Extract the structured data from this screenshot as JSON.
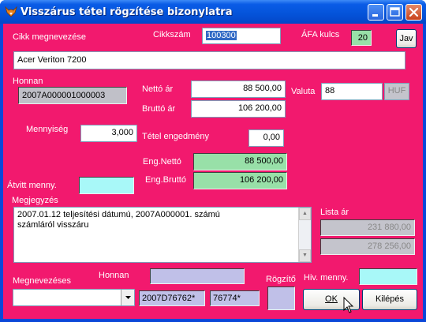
{
  "window": {
    "title": "Visszárus tétel rögzítése bizonylatra"
  },
  "labels": {
    "cikk_megnevezese": "Cikk megnevezése",
    "cikkszam": "Cikkszám",
    "afa_kulcs": "ÁFA kulcs",
    "honnan": "Honnan",
    "netto_ar": "Nettó ár",
    "brutto_ar": "Bruttó ár",
    "valuta": "Valuta",
    "mennyiseg": "Mennyiség",
    "tetel_engedmeny": "Tétel engedmény",
    "eng_netto": "Eng.Nettó",
    "eng_brutto": "Eng.Bruttó",
    "atvitt_menny": "Átvitt menny.",
    "megjegyzes": "Megjegyzés",
    "lista_ar": "Lista ár",
    "megnevezeses": "Megnevezéses",
    "honnan2": "Honnan",
    "rogzito": "Rögzítő",
    "hiv_menny": "Hiv. menny."
  },
  "values": {
    "cikkszam": "100300",
    "afa_kulcs": "20",
    "cikk_megnevezese": "Acer Veriton 7200",
    "honnan": "2007A000001000003",
    "netto_ar": "88 500,00",
    "brutto_ar": "106 200,00",
    "valuta_amount": "88",
    "valuta_currency": "HUF",
    "mennyiseg": "3,000",
    "tetel_engedmeny": "0,00",
    "eng_netto": "88 500,00",
    "eng_brutto": "106 200,00",
    "atvitt_menny": "",
    "megjegyzes_line1": "2007.01.12 teljesítési dátumú, 2007A000001. számú",
    "megjegyzes_line2": "számláról visszáru",
    "lista_ar_1": "231 880,00",
    "lista_ar_2": "278 256,00",
    "megnevezeses_select": "",
    "honnan2": "",
    "code1": "2007D76762*",
    "code2": "76774*",
    "rogzito": "",
    "hiv_menny": ""
  },
  "buttons": {
    "jav": "Jav",
    "ok": "OK",
    "kilepes": "Kilépés"
  },
  "colors": {
    "background": "#f2196e",
    "titlebar": "#0453d9",
    "green_field": "#98e0a8",
    "cyan_field": "#a8f8f8"
  },
  "icons": {
    "title": "fox-logo-icon",
    "minimize": "minimize-icon",
    "maximize": "maximize-icon",
    "close": "close-icon",
    "dropdown": "chevron-down-icon",
    "cursor": "mouse-pointer-icon"
  }
}
